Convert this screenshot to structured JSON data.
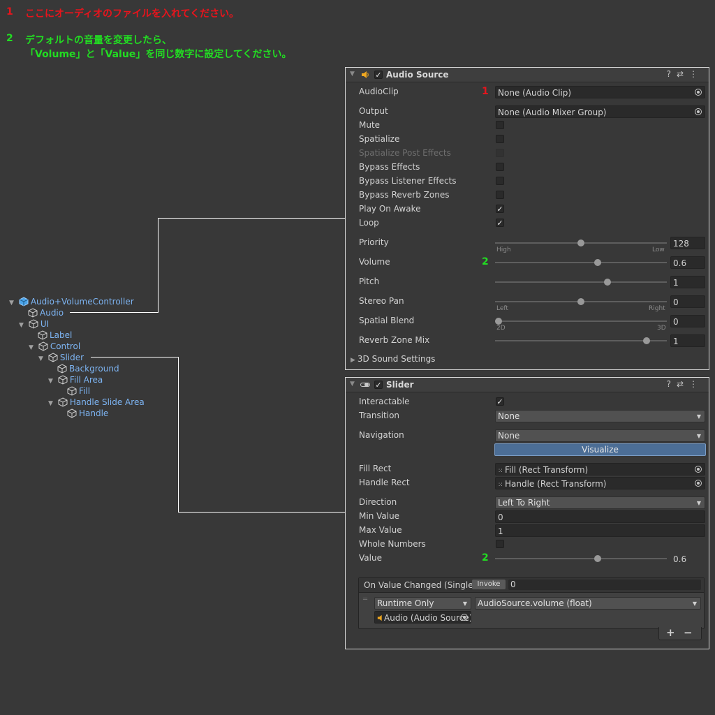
{
  "notes": {
    "n1_num": "1",
    "n1_text": "ここにオーディオのファイルを入れてください。",
    "n2_num": "2",
    "n2_line1": "デフォルトの音量を変更したら、",
    "n2_line2": "「Volume」と「Value」を同じ数字に設定してください。"
  },
  "hierarchy": {
    "items": [
      {
        "label": "Audio+VolumeController"
      },
      {
        "label": "Audio"
      },
      {
        "label": "UI"
      },
      {
        "label": "Label"
      },
      {
        "label": "Control"
      },
      {
        "label": "Slider"
      },
      {
        "label": "Background"
      },
      {
        "label": "Fill Area"
      },
      {
        "label": "Fill"
      },
      {
        "label": "Handle Slide Area"
      },
      {
        "label": "Handle"
      }
    ]
  },
  "audio_source": {
    "title": "Audio Source",
    "enabled": true,
    "audioclip_label": "AudioClip",
    "audioclip_marker": "1",
    "audioclip_value": "None (Audio Clip)",
    "output_label": "Output",
    "output_value": "None (Audio Mixer Group)",
    "toggles": [
      {
        "label": "Mute",
        "checked": false
      },
      {
        "label": "Spatialize",
        "checked": false
      },
      {
        "label": "Spatialize Post Effects",
        "checked": false,
        "disabled": true
      },
      {
        "label": "Bypass Effects",
        "checked": false
      },
      {
        "label": "Bypass Listener Effects",
        "checked": false
      },
      {
        "label": "Bypass Reverb Zones",
        "checked": false
      },
      {
        "label": "Play On Awake",
        "checked": true,
        "mark": "✓"
      },
      {
        "label": "Loop",
        "checked": true,
        "mark": "✓"
      }
    ],
    "priority": {
      "label": "Priority",
      "value": "128",
      "level": 0.5,
      "min_label": "High",
      "max_label": "Low"
    },
    "volume": {
      "label": "Volume",
      "marker": "2",
      "value": "0.6",
      "level": 0.6
    },
    "pitch": {
      "label": "Pitch",
      "value": "1",
      "level": 0.66
    },
    "stereo_pan": {
      "label": "Stereo Pan",
      "value": "0",
      "level": 0.5,
      "min_label": "Left",
      "max_label": "Right"
    },
    "spatial_blend": {
      "label": "Spatial Blend",
      "value": "0",
      "level": 0.0,
      "min_label": "2D",
      "max_label": "3D"
    },
    "reverb_zone_mix": {
      "label": "Reverb Zone Mix",
      "value": "1",
      "level": 0.9
    },
    "sound_settings_label": "3D Sound Settings"
  },
  "slider": {
    "title": "Slider",
    "enabled": true,
    "interactable_label": "Interactable",
    "interactable_mark": "✓",
    "transition_label": "Transition",
    "transition_value": "None",
    "navigation_label": "Navigation",
    "navigation_value": "None",
    "visualize_label": "Visualize",
    "fill_rect_label": "Fill Rect",
    "fill_rect_value": "Fill (Rect Transform)",
    "handle_rect_label": "Handle Rect",
    "handle_rect_value": "Handle (Rect Transform)",
    "direction_label": "Direction",
    "direction_value": "Left To Right",
    "min_value_label": "Min Value",
    "min_value": "0",
    "max_value_label": "Max Value",
    "max_value": "1",
    "whole_numbers_label": "Whole Numbers",
    "value_label": "Value",
    "value_marker": "2",
    "value": "0.6",
    "value_level": 0.6,
    "event_label": "On Value Changed (Single)",
    "invoke_label": "Invoke",
    "invoke_value": "0",
    "runtime_value": "Runtime Only",
    "function_value": "AudioSource.volume (float)",
    "target_value": "Audio (Audio Source)",
    "add_label": "+",
    "remove_label": "−"
  },
  "colors": {
    "note_red": "#e8141c",
    "note_green": "#22dd22",
    "hierarchy_text": "#7db4f2",
    "visualize_button": "#4c6e96"
  }
}
